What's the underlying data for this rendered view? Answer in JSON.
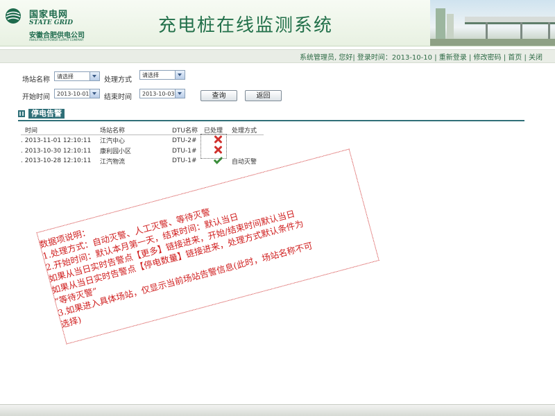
{
  "header": {
    "logo_cn": "国家电网",
    "logo_en": "STATE GRID",
    "company": "安徽合肥供电公司",
    "company_en": "ANHUI HEFEI POWER SUPPLY COMPANY",
    "title": "充电桩在线监测系统"
  },
  "userbar": {
    "greeting": "系统管理员, 您好| 登录时间：2013-10-10",
    "relogin": "重新登录",
    "change_password": "修改密码",
    "home": "首页",
    "close": "关闭",
    "sep": "|"
  },
  "filters": {
    "station_label": "场站名称",
    "station_value": "请选择",
    "method_label": "处理方式",
    "method_value": "请选择",
    "start_label": "开始时间",
    "start_value": "2013-10-01",
    "end_label": "结束时间",
    "end_value": "2013-10-03",
    "query_button": "查询",
    "back_button": "返回"
  },
  "section": {
    "title": "停电告警"
  },
  "table": {
    "headers": [
      "时间",
      "场站名称",
      "DTU名称",
      "已处理",
      "处理方式"
    ],
    "rows": [
      {
        "time": "2013-11-01 12:10:11",
        "station": "江汽中心",
        "dtu": "DTU-2#",
        "handled": "x-icon",
        "method": ""
      },
      {
        "time": "2013-10-30 12:10:11",
        "station": "康利园小区",
        "dtu": "DTU-1#",
        "handled": "x-icon",
        "method": ""
      },
      {
        "time": "2013-10-28 12:10:11",
        "station": "江汽物流",
        "dtu": "DTU-1#",
        "handled": "check-icon",
        "method": "自动灭警"
      }
    ],
    "row_prefix": "."
  },
  "note": {
    "lines": [
      "数据项说明：",
      "1.处理方式：自动灭警、人工灭警、等待灭警",
      "2.开始时间：默认本月第一天，结束时间：默认当日",
      "   如果从当日实时告警点【更多】链接进来，开始/结束时间默认当日",
      "   如果从当日实时告警点【停电数量】链接进来，处理方式默认条件为",
      "“等待灭警”",
      "3.如果进入具体场站，仅显示当前场站告警信息(此时，场站名称不可",
      "选择)"
    ]
  },
  "colors": {
    "brand_green": "#22704a",
    "note_red": "#d02020",
    "section_teal": "#2f6f78"
  }
}
